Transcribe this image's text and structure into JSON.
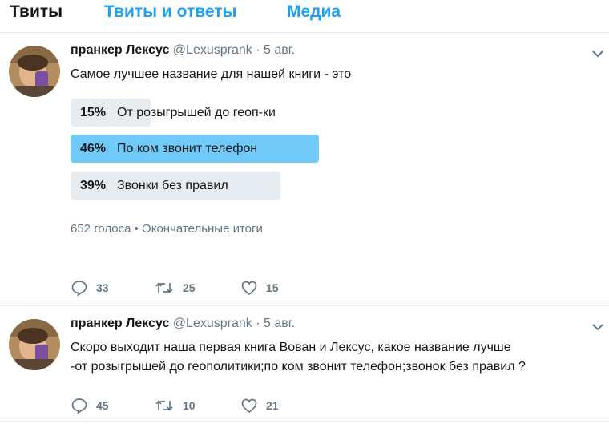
{
  "tabs": [
    "Твиты",
    "Твиты и ответы",
    "Медиа"
  ],
  "tweets": [
    {
      "author": {
        "name": "пранкер Лексус",
        "handle": "@Lexusprank",
        "separator": "·",
        "date": "5 авг."
      },
      "text": "Самое лучшее название  для нашей книги - это",
      "poll": {
        "options": [
          {
            "percent": "15%",
            "label": "От розыгрышей до геоп-ки"
          },
          {
            "percent": "46%",
            "label": "По ком звонит телефон"
          },
          {
            "percent": "39%",
            "label": "Звонки без правил"
          }
        ],
        "summary": "652 голоса • Окончательные итоги"
      },
      "counts": {
        "replies": "33",
        "retweets": "25",
        "likes": "15"
      }
    },
    {
      "author": {
        "name": "пранкер Лексус",
        "handle": "@Lexusprank",
        "separator": "·",
        "date": "5 авг."
      },
      "text_lines": [
        "Скоро выходит наша первая книга Вован и Лексус, какое название лучше",
        "-от розыгрышей до геополитики;по ком звонит телефон;звонок без правил ?"
      ],
      "counts": {
        "replies": "45",
        "retweets": "10",
        "likes": "21"
      }
    }
  ],
  "colors": {
    "accent": "#1da1f2",
    "poll_winner": "#71c9f8",
    "poll_other": "#e6ecf0",
    "muted": "#657786"
  }
}
